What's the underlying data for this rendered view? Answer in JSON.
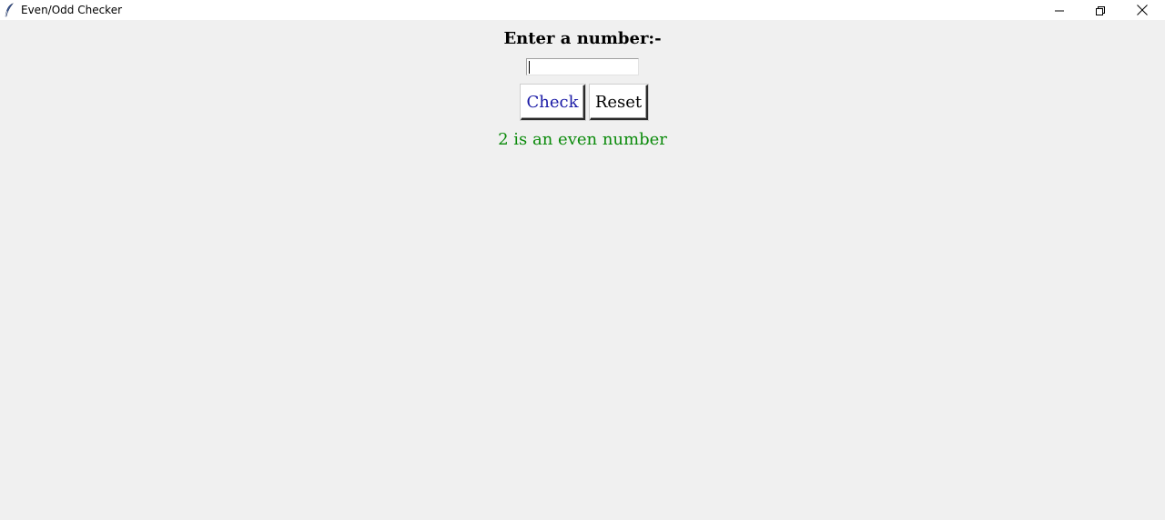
{
  "window": {
    "title": "Even/Odd Checker",
    "minimize_label": "",
    "maximize_label": "",
    "close_label": ""
  },
  "form": {
    "prompt": "Enter a number:-",
    "input_value": "",
    "check_label": "Check",
    "reset_label": "Reset",
    "result": "2 is an even number"
  },
  "colors": {
    "background": "#f0f0f0",
    "check_text": "#1a1aa6",
    "result_text": "#0a8a0a"
  }
}
